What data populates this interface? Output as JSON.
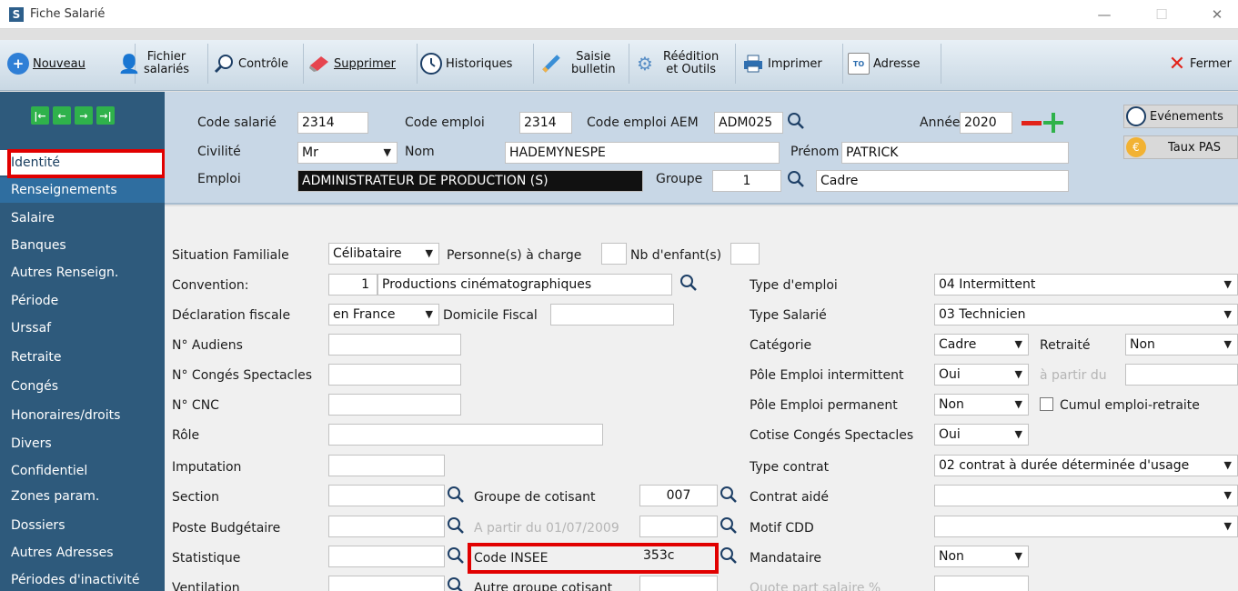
{
  "window": {
    "title": "Fiche Salarié",
    "app_icon": "S"
  },
  "toolbar": {
    "nouveau": "Nouveau",
    "fichier_l1": "Fichier",
    "fichier_l2": "salariés",
    "controle": "Contrôle",
    "supprimer": "Supprimer",
    "historiques": "Historiques",
    "saisie_l1": "Saisie",
    "saisie_l2": "bulletin",
    "reedition_l1": "Réédition",
    "reedition_l2": "et Outils",
    "imprimer": "Imprimer",
    "adresse": "Adresse",
    "adresse_icon_text": "TO",
    "fermer": "Fermer"
  },
  "sidebar": {
    "items": [
      "Identité",
      "Renseignements",
      "Salaire",
      "Banques",
      "Autres Renseign.",
      "Période",
      "Urssaf",
      "Retraite",
      "Congés",
      "Honoraires/droits",
      "Divers",
      "Confidentiel",
      "Zones param.",
      "Dossiers",
      "Autres Adresses",
      "Périodes d'inactivité"
    ],
    "active": "Identité",
    "selected": "Renseignements"
  },
  "header": {
    "code_salarie_label": "Code salarié",
    "code_salarie": "2314",
    "code_emploi_label": "Code emploi",
    "code_emploi": "2314",
    "code_emploi_aem_label": "Code emploi AEM",
    "code_emploi_aem": "ADM025",
    "annee_label": "Année",
    "annee": "2020",
    "civilite_label": "Civilité",
    "civilite": "Mr",
    "nom_label": "Nom",
    "nom": "HADEMYNESPE",
    "prenom_label": "Prénom",
    "prenom": "PATRICK",
    "emploi_label": "Emploi",
    "emploi": "ADMINISTRATEUR DE PRODUCTION (S)",
    "groupe_label": "Groupe",
    "groupe": "1",
    "groupe_name": "Cadre",
    "evenements": "Evénements",
    "taux_pas": "Taux PAS"
  },
  "form": {
    "situation_label": "Situation Familiale",
    "situation": "Célibataire",
    "personnes_label": "Personne(s) à charge",
    "enfants_label": "Nb d'enfant(s)",
    "convention_label": "Convention:",
    "convention_num": "1",
    "convention": "Productions cinématographiques",
    "declaration_label": "Déclaration fiscale",
    "declaration": "en France",
    "domicile_label": "Domicile Fiscal",
    "audiens_label": "N° Audiens",
    "conges_spect_label": "N° Congés Spectacles",
    "cnc_label": "N° CNC",
    "role_label": "Rôle",
    "imputation_label": "Imputation",
    "section_label": "Section",
    "groupe_cotisant_label": "Groupe de cotisant",
    "groupe_cotisant": "007",
    "poste_label": "Poste Budgétaire",
    "a_partir_2009": "A partir du 01/07/2009",
    "statistique_label": "Statistique",
    "code_insee_label": "Code INSEE",
    "code_insee": "353c",
    "ventilation_label": "Ventilation",
    "autre_groupe_label": "Autre groupe cotisant",
    "type_emploi_label": "Type d'emploi",
    "type_emploi": "04 Intermittent",
    "type_salarie_label": "Type Salarié",
    "type_salarie": "03 Technicien",
    "categorie_label": "Catégorie",
    "categorie": "Cadre",
    "retraite_label": "Retraité",
    "retraite": "Non",
    "pole_inter_label": "Pôle Emploi intermittent",
    "pole_inter": "Oui",
    "a_partir_du": "à partir du",
    "pole_perm_label": "Pôle Emploi permanent",
    "pole_perm": "Non",
    "cumul_label": "Cumul emploi-retraite",
    "cotise_label": "Cotise Congés Spectacles",
    "cotise": "Oui",
    "type_contrat_label": "Type contrat",
    "type_contrat": "02 contrat à durée déterminée d'usage",
    "contrat_aide_label": "Contrat aidé",
    "motif_cdd_label": "Motif CDD",
    "mandataire_label": "Mandataire",
    "mandataire": "Non",
    "quote_part_label": "Quote part salaire %"
  },
  "colors": {
    "sidebar": "#2e5a7c",
    "header": "#c8d7e6",
    "highlight": "#e10000",
    "nav_green": "#2fb24b"
  }
}
